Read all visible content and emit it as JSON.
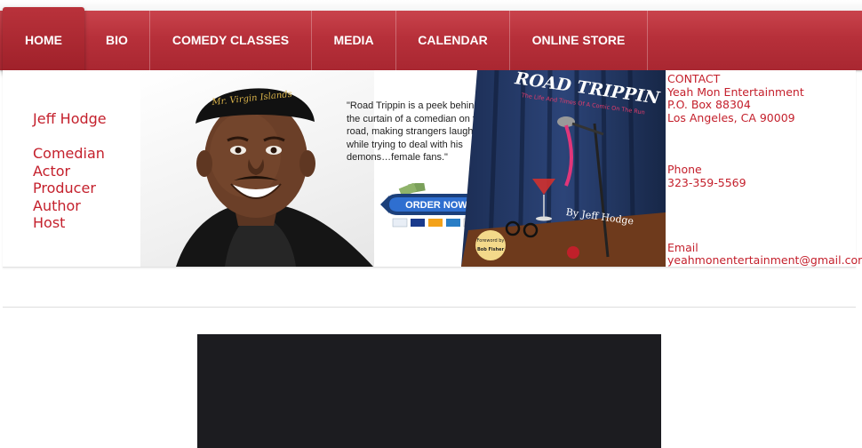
{
  "nav": {
    "items": [
      {
        "label": "HOME"
      },
      {
        "label": "BIO"
      },
      {
        "label": "COMEDY CLASSES"
      },
      {
        "label": "MEDIA"
      },
      {
        "label": "CALENDAR"
      },
      {
        "label": "ONLINE STORE"
      }
    ]
  },
  "sidebar": {
    "name": "Jeff Hodge",
    "roles": [
      "Comedian",
      "Actor",
      "Producer",
      "Author",
      "Host"
    ]
  },
  "banner": {
    "hat_text": "Mr. Virgin Islands",
    "quote": "\"Road Trippin is a peek behind the curtain of a comedian on the road, making strangers laugh while trying to deal with his demons…female fans.\"",
    "order_button": "ORDER NOW",
    "payment_icons": [
      "PayPal",
      "VISA",
      "MasterCard",
      "AmEx",
      "Discover"
    ],
    "book_title": "ROAD TRIPPIN",
    "book_subtitle": "The Life And Times Of A Comic On The Run",
    "book_author": "By Jeff Hodge",
    "book_foreword_line1": "Foreword by",
    "book_foreword_line2": "Bob Fisher"
  },
  "contact": {
    "heading": "CONTACT",
    "company": "Yeah Mon Entertainment",
    "address1": "P.O. Box 88304",
    "address2": "Los Angeles, CA 90009",
    "phone_label": "Phone",
    "phone": "323-359-5569",
    "email_label": "Email",
    "email": "yeahmonentertainment@gmail.com"
  },
  "colors": {
    "nav_red": "#b7303a",
    "text_red": "#c4202c",
    "video_bg": "#1c1c20"
  }
}
